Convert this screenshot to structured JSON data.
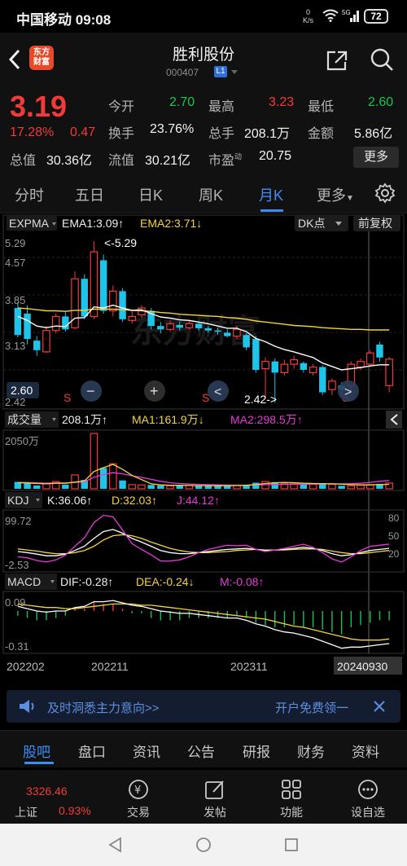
{
  "status_bar": {
    "carrier": "中国移动",
    "time": "09:08",
    "net_speed_value": "0",
    "net_speed_unit": "K/s",
    "signal_label": "5G",
    "battery": "72"
  },
  "header": {
    "logo_line1": "东方",
    "logo_line2": "财富",
    "stock_name": "胜利股份",
    "stock_code": "000407",
    "level_badge": "L1"
  },
  "quote": {
    "price": "3.19",
    "change_pct": "17.28%",
    "change_amt": "0.47",
    "fields": {
      "open_label": "今开",
      "open_value": "2.70",
      "high_label": "最高",
      "high_value": "3.23",
      "low_label": "最低",
      "low_value": "2.60",
      "turnover_label": "换手",
      "turnover_value": "23.76%",
      "volume_label": "总手",
      "volume_value": "208.1万",
      "amount_label": "金额",
      "amount_value": "5.86亿",
      "mktcap_label": "总值",
      "mktcap_value": "30.36亿",
      "float_label": "流值",
      "float_value": "30.21亿",
      "pe_label": "市盈",
      "pe_sup": "动",
      "pe_value": "20.75"
    },
    "more_button": "更多"
  },
  "tabs": {
    "items": [
      "分时",
      "五日",
      "日K",
      "周K",
      "月K",
      "更多"
    ],
    "active_index": 4
  },
  "chart_data": [
    {
      "type": "candlestick",
      "panel": "main",
      "indicator": "EXPMA",
      "ema1_label": "EMA1:3.09",
      "ema1_arrow": "↑",
      "ema2_label": "EMA2:3.71",
      "ema2_arrow": "↓",
      "dk_button": "DK点",
      "adjust_button": "前复权",
      "y_ticks": [
        "5.29",
        "4.57",
        "3.85",
        "3.13",
        "2.60",
        "2.42"
      ],
      "price_range": [
        2.42,
        5.29
      ],
      "current_price_label": "2.60",
      "annotations": {
        "high": "<-5.29",
        "low": "2.42->"
      },
      "sell_marks": [
        "S",
        "S",
        "S"
      ],
      "candles": [
        {
          "o": 4.1,
          "c": 3.62,
          "h": 4.2,
          "l": 3.58
        },
        {
          "o": 4.0,
          "c": 3.55,
          "h": 4.15,
          "l": 3.45
        },
        {
          "o": 3.52,
          "c": 3.35,
          "h": 3.6,
          "l": 3.25
        },
        {
          "o": 3.32,
          "c": 3.7,
          "h": 3.78,
          "l": 3.3
        },
        {
          "o": 3.7,
          "c": 3.95,
          "h": 4.0,
          "l": 3.65
        },
        {
          "o": 3.95,
          "c": 3.72,
          "h": 4.05,
          "l": 3.68
        },
        {
          "o": 3.75,
          "c": 4.62,
          "h": 4.75,
          "l": 3.72
        },
        {
          "o": 4.62,
          "c": 3.95,
          "h": 4.7,
          "l": 3.9
        },
        {
          "o": 3.95,
          "c": 5.1,
          "h": 5.29,
          "l": 3.9
        },
        {
          "o": 4.95,
          "c": 4.05,
          "h": 5.05,
          "l": 4.0
        },
        {
          "o": 4.05,
          "c": 4.4,
          "h": 4.5,
          "l": 3.95
        },
        {
          "o": 4.4,
          "c": 3.9,
          "h": 4.45,
          "l": 3.85
        },
        {
          "o": 3.88,
          "c": 3.95,
          "h": 4.05,
          "l": 3.82
        },
        {
          "o": 3.98,
          "c": 4.1,
          "h": 4.15,
          "l": 3.92
        },
        {
          "o": 4.05,
          "c": 3.78,
          "h": 4.1,
          "l": 3.72
        },
        {
          "o": 3.78,
          "c": 3.72,
          "h": 3.85,
          "l": 3.65
        },
        {
          "o": 3.72,
          "c": 3.82,
          "h": 3.88,
          "l": 3.68
        },
        {
          "o": 3.8,
          "c": 3.75,
          "h": 3.86,
          "l": 3.7
        },
        {
          "o": 3.75,
          "c": 3.82,
          "h": 3.88,
          "l": 3.72
        },
        {
          "o": 3.82,
          "c": 3.74,
          "h": 3.85,
          "l": 3.7
        },
        {
          "o": 3.74,
          "c": 3.7,
          "h": 3.78,
          "l": 3.66
        },
        {
          "o": 3.7,
          "c": 3.68,
          "h": 3.75,
          "l": 3.62
        },
        {
          "o": 3.66,
          "c": 3.6,
          "h": 3.72,
          "l": 3.58
        },
        {
          "o": 3.6,
          "c": 3.72,
          "h": 3.78,
          "l": 3.55
        },
        {
          "o": 3.62,
          "c": 3.4,
          "h": 3.65,
          "l": 3.35
        },
        {
          "o": 3.55,
          "c": 3.0,
          "h": 3.6,
          "l": 2.95
        },
        {
          "o": 3.02,
          "c": 3.15,
          "h": 3.22,
          "l": 2.5
        },
        {
          "o": 3.15,
          "c": 2.95,
          "h": 3.2,
          "l": 2.42
        },
        {
          "o": 2.95,
          "c": 3.1,
          "h": 3.18,
          "l": 2.9
        },
        {
          "o": 3.1,
          "c": 3.18,
          "h": 3.25,
          "l": 3.02
        },
        {
          "o": 3.12,
          "c": 3.0,
          "h": 3.15,
          "l": 2.95
        },
        {
          "o": 2.95,
          "c": 3.05,
          "h": 3.1,
          "l": 2.9
        },
        {
          "o": 3.05,
          "c": 2.6,
          "h": 3.08,
          "l": 2.55
        },
        {
          "o": 2.65,
          "c": 2.8,
          "h": 2.85,
          "l": 2.55
        },
        {
          "o": 2.72,
          "c": 2.65,
          "h": 2.78,
          "l": 2.55
        },
        {
          "o": 2.72,
          "c": 3.1,
          "h": 3.15,
          "l": 2.65
        },
        {
          "o": 3.05,
          "c": 3.15,
          "h": 3.2,
          "l": 3.0
        },
        {
          "o": 3.1,
          "c": 3.3,
          "h": 3.35,
          "l": 3.05
        },
        {
          "o": 3.45,
          "c": 3.22,
          "h": 3.5,
          "l": 3.15
        },
        {
          "o": 2.72,
          "c": 3.19,
          "h": 3.23,
          "l": 2.6
        }
      ],
      "ema1": [
        3.95,
        3.88,
        3.78,
        3.75,
        3.78,
        3.77,
        3.92,
        3.93,
        4.12,
        4.1,
        4.15,
        4.1,
        4.06,
        4.07,
        4.0,
        3.94,
        3.92,
        3.89,
        3.88,
        3.85,
        3.82,
        3.78,
        3.74,
        3.74,
        3.68,
        3.56,
        3.5,
        3.42,
        3.36,
        3.32,
        3.27,
        3.22,
        3.12,
        3.06,
        3.0,
        3.02,
        3.04,
        3.07,
        3.09,
        3.09
      ],
      "ema2": [
        4.1,
        4.09,
        4.07,
        4.05,
        4.05,
        4.04,
        4.06,
        4.06,
        4.08,
        4.08,
        4.08,
        4.07,
        4.06,
        4.05,
        4.04,
        4.02,
        4.01,
        3.99,
        3.98,
        3.97,
        3.96,
        3.95,
        3.93,
        3.92,
        3.9,
        3.87,
        3.85,
        3.83,
        3.81,
        3.79,
        3.78,
        3.77,
        3.75,
        3.74,
        3.73,
        3.72,
        3.72,
        3.71,
        3.71,
        3.71
      ]
    },
    {
      "type": "bar",
      "panel": "volume",
      "title": "成交量",
      "vol_label": "208.1万",
      "vol_arrow": "↑",
      "ma1_label": "MA1:161.9万",
      "ma1_arrow": "↓",
      "ma2_label": "MA2:298.5万",
      "ma2_arrow": "↑",
      "y_max_label": "2050万",
      "y_max": 2050,
      "volumes": [
        250,
        200,
        120,
        180,
        260,
        150,
        500,
        320,
        1990,
        750,
        900,
        300,
        150,
        140,
        140,
        120,
        110,
        130,
        120,
        110,
        100,
        110,
        120,
        130,
        150,
        220,
        260,
        240,
        200,
        200,
        180,
        160,
        200,
        160,
        110,
        110,
        130,
        150,
        180,
        208
      ],
      "ma1": [
        220,
        210,
        190,
        180,
        200,
        200,
        240,
        280,
        620,
        760,
        880,
        700,
        480,
        330,
        180,
        140,
        130,
        125,
        120,
        118,
        115,
        112,
        115,
        118,
        125,
        150,
        190,
        215,
        230,
        220,
        200,
        190,
        185,
        180,
        165,
        150,
        140,
        140,
        150,
        161.9
      ],
      "ma2": [
        230,
        225,
        215,
        205,
        210,
        210,
        230,
        250,
        420,
        510,
        580,
        540,
        470,
        410,
        340,
        270,
        220,
        190,
        170,
        160,
        150,
        140,
        135,
        132,
        130,
        135,
        145,
        155,
        160,
        165,
        168,
        170,
        175,
        178,
        180,
        185,
        200,
        230,
        270,
        298.5
      ]
    },
    {
      "type": "line",
      "panel": "kdj",
      "title": "KDJ",
      "k_label": "K:36.06",
      "k_arrow": "↑",
      "d_label": "D:32.03",
      "d_arrow": "↑",
      "j_label": "J:44.12",
      "j_arrow": "↑",
      "y_ticks_left": [
        "99.72",
        "-2.53"
      ],
      "y_ticks_right": [
        "80",
        "50",
        "20"
      ],
      "y_range": [
        -2.53,
        99.72
      ],
      "k": [
        30,
        28,
        25,
        22,
        22,
        25,
        32,
        40,
        55,
        68,
        72,
        65,
        55,
        48,
        40,
        32,
        28,
        26,
        26,
        28,
        30,
        32,
        34,
        35,
        36,
        34,
        32,
        33,
        34,
        36,
        38,
        36,
        32,
        26,
        22,
        24,
        28,
        32,
        34,
        36.06
      ],
      "d": [
        35,
        33,
        31,
        28,
        26,
        26,
        28,
        32,
        40,
        52,
        60,
        62,
        60,
        55,
        48,
        42,
        36,
        32,
        29,
        28,
        28,
        29,
        30,
        32,
        33,
        34,
        33,
        33,
        33,
        34,
        35,
        35,
        34,
        31,
        28,
        26,
        26,
        28,
        30,
        32.03
      ],
      "j": [
        20,
        18,
        13,
        10,
        14,
        23,
        40,
        56,
        85,
        99,
        96,
        71,
        45,
        34,
        24,
        12,
        12,
        14,
        20,
        28,
        34,
        38,
        42,
        41,
        42,
        34,
        30,
        33,
        36,
        40,
        44,
        38,
        28,
        16,
        10,
        20,
        32,
        40,
        42,
        44.12
      ]
    },
    {
      "type": "line",
      "panel": "macd",
      "title": "MACD",
      "dif_label": "DIF:-0.28",
      "dif_arrow": "↑",
      "dea_label": "DEA:-0.24",
      "dea_arrow": "↓",
      "m_label": "M:-0.08",
      "m_arrow": "↑",
      "y_ticks": [
        "0.09",
        "-0.31"
      ],
      "y_range": [
        -0.35,
        0.14
      ],
      "dif": [
        0.04,
        0.02,
        0.0,
        -0.01,
        0.0,
        0.0,
        0.03,
        0.04,
        0.08,
        0.08,
        0.09,
        0.07,
        0.05,
        0.04,
        0.02,
        0.0,
        -0.01,
        -0.02,
        -0.02,
        -0.03,
        -0.04,
        -0.05,
        -0.06,
        -0.06,
        -0.08,
        -0.11,
        -0.13,
        -0.16,
        -0.18,
        -0.19,
        -0.21,
        -0.23,
        -0.26,
        -0.29,
        -0.32,
        -0.31,
        -0.31,
        -0.3,
        -0.29,
        -0.28
      ],
      "dea": [
        0.06,
        0.05,
        0.04,
        0.03,
        0.03,
        0.02,
        0.02,
        0.03,
        0.04,
        0.05,
        0.06,
        0.06,
        0.06,
        0.05,
        0.05,
        0.04,
        0.03,
        0.02,
        0.01,
        0.0,
        -0.01,
        -0.02,
        -0.03,
        -0.04,
        -0.05,
        -0.06,
        -0.07,
        -0.09,
        -0.11,
        -0.13,
        -0.14,
        -0.16,
        -0.18,
        -0.2,
        -0.22,
        -0.24,
        -0.25,
        -0.25,
        -0.25,
        -0.24
      ],
      "x_labels": [
        "202202",
        "202211",
        "202311",
        "20240930"
      ]
    }
  ],
  "chart_controls": {
    "minus": "−",
    "plus": "+",
    "left": "<",
    "right": ">"
  },
  "banner": {
    "text": "及时洞悉主力意向>>",
    "open_account": "开户免费领一"
  },
  "sub_tabs": {
    "items": [
      "股吧",
      "盘口",
      "资讯",
      "公告",
      "研报",
      "财务",
      "资料"
    ],
    "active_index": 0
  },
  "bottom_nav": {
    "index_value": "3326.46",
    "index_name": "上证",
    "index_change": "0.93%",
    "items": [
      "交易",
      "发帖",
      "功能",
      "设自选"
    ]
  },
  "colors": {
    "up": "#f23a3a",
    "down": "#1fc4e8",
    "accent": "#3d8df5",
    "ema1": "#ffffff",
    "ema2": "#f5d33c",
    "ma2": "#e83ad9"
  }
}
